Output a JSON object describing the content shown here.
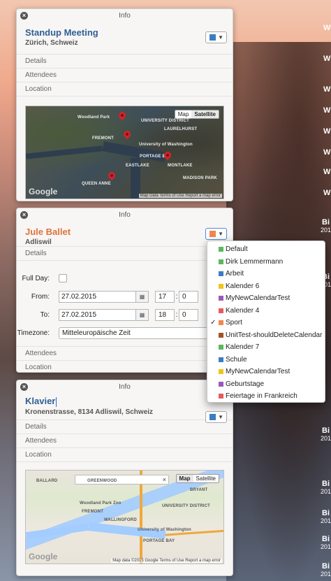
{
  "desktop": {
    "labels": [
      "W",
      "W",
      "W",
      "W",
      "W",
      "W",
      "W",
      "W",
      "Bi",
      "201",
      "Bi",
      "201",
      "Bi",
      "201",
      "Bi",
      "201",
      "Bi",
      "201",
      "Bi",
      "201",
      "Bi",
      "201"
    ]
  },
  "panel1": {
    "title": "Info",
    "event_title": "Standup Meeting",
    "location": "Zürich, Schweiz",
    "color": "#3b7dc4",
    "rows": [
      "Details",
      "Attendees",
      "Location"
    ],
    "map": {
      "mode_map": "Map",
      "mode_satellite": "Satellite",
      "labels": [
        "Woodland Park",
        "FREMONT",
        "UNIVERSITY DISTRICT",
        "LAURELHURST",
        "University of Washington",
        "PORTAGE BAY",
        "EASTLAKE",
        "MONTLAKE",
        "MADISON PARK",
        "QUEEN ANNE"
      ],
      "google": "Google",
      "attribution": "Map Data  Terms of Use  Report a map error"
    }
  },
  "panel2": {
    "title": "Info",
    "event_title": "Jule Ballet",
    "location": "Adliswil",
    "color": "#f0874f",
    "details": "Details",
    "full_day_label": "Full Day:",
    "from_label": "From:",
    "to_label": "To:",
    "from_date": "27.02.2015",
    "from_hour": "17",
    "from_min": "0",
    "to_date": "27.02.2015",
    "to_hour": "18",
    "to_min": "0",
    "timezone_label": "Timezone:",
    "timezone_value": "Mitteleuropäische Zeit",
    "attendees": "Attendees",
    "location_row": "Location"
  },
  "dropdown": {
    "items": [
      {
        "label": "Default",
        "color": "#5cb85c",
        "checked": false
      },
      {
        "label": "Dirk Lemmermann",
        "color": "#5cb85c",
        "checked": false
      },
      {
        "label": "Arbeit",
        "color": "#3b7dc4",
        "checked": false
      },
      {
        "label": "Kalender 6",
        "color": "#f0c419",
        "checked": false
      },
      {
        "label": "MyNewCalendarTest",
        "color": "#9b59b6",
        "checked": false
      },
      {
        "label": "Kalender 4",
        "color": "#e25d5d",
        "checked": false
      },
      {
        "label": "Sport",
        "color": "#f0874f",
        "checked": true
      },
      {
        "label": "UnitTest-shouldDeleteCalendar",
        "color": "#a0522d",
        "checked": false
      },
      {
        "label": "Kalender 7",
        "color": "#5cb85c",
        "checked": false
      },
      {
        "label": "Schule",
        "color": "#3b7dc4",
        "checked": false
      },
      {
        "label": "MyNewCalendarTest",
        "color": "#f0c419",
        "checked": false
      },
      {
        "label": "Geburtstage",
        "color": "#9b59b6",
        "checked": false
      },
      {
        "label": "Feiertage in Frankreich",
        "color": "#e25d5d",
        "checked": false
      }
    ]
  },
  "panel3": {
    "title": "Info",
    "event_title": "Klavier",
    "location": "Kronenstrasse, 8134 Adliswil, Schweiz",
    "color": "#3b7dc4",
    "rows": [
      "Details",
      "Attendees",
      "Location"
    ],
    "map": {
      "mode_map": "Map",
      "mode_satellite": "Satellite",
      "labels": [
        "BALLARD",
        "GREENWOOD",
        "Woodland Park Zoo",
        "FREMONT",
        "BRYANT",
        "UNIVERSITY DISTRICT",
        "University of Washington",
        "WALLINGFORD",
        "PORTAGE BAY"
      ],
      "google": "Google",
      "attribution": "Map data ©2015 Google  Terms of Use  Report a map error"
    }
  }
}
